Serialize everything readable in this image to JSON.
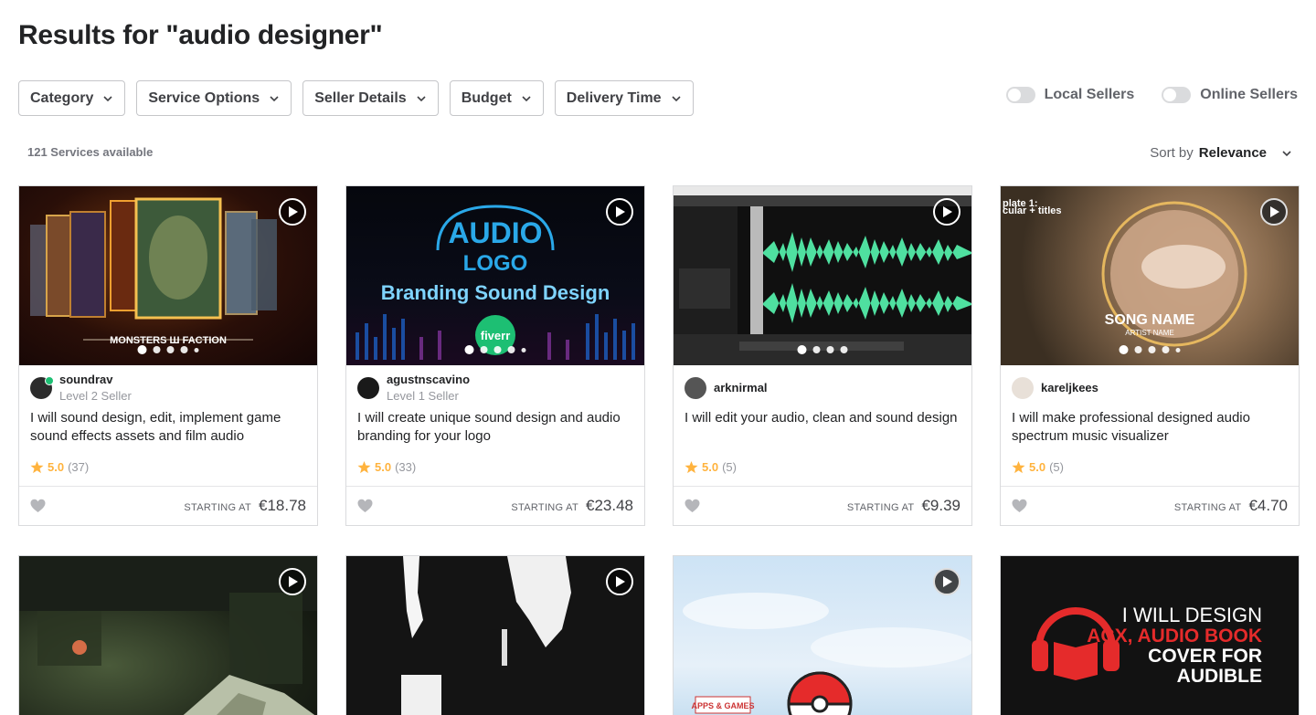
{
  "page_title": "Results for \"audio designer\"",
  "filters": [
    {
      "label": "Category"
    },
    {
      "label": "Service Options"
    },
    {
      "label": "Seller Details"
    },
    {
      "label": "Budget"
    },
    {
      "label": "Delivery Time"
    }
  ],
  "toggles": {
    "local": "Local Sellers",
    "online": "Online Sellers"
  },
  "services_count": "121 Services available",
  "sort": {
    "label": "Sort by",
    "value": "Relevance"
  },
  "price_label": "STARTING AT",
  "colors": {
    "rating": "#ffb33e",
    "online": "#1dbf73",
    "waveform": "#4fe0a0",
    "accent_red": "#e52b2b"
  },
  "thumb_text": {
    "g1_caption": "MONSTERS Ш FACTION",
    "g2_line1": "AUDIO",
    "g2_line2": "LOGO",
    "g2_line3": "Branding Sound Design",
    "g2_badge": "fiverr",
    "g4_top": "plate 1:",
    "g4_top2": "cular + titles",
    "g4_song": "SONG NAME",
    "g4_artist": "ARTIST NAME",
    "g7_tag": "APPS & GAMES",
    "g8_line1": "I WILL DESIGN",
    "g8_line2": "ACX, AUDIO BOOK",
    "g8_line3": "COVER FOR",
    "g8_line4": "AUDIBLE"
  },
  "gigs": [
    {
      "seller": "soundrav",
      "level": "Level 2 Seller",
      "title": "I will sound design, edit, implement game sound effects assets and film audio",
      "score": "5.0",
      "reviews": "(37)",
      "price": "€18.78"
    },
    {
      "seller": "agustnscavino",
      "level": "Level 1 Seller",
      "title": "I will create unique sound design and audio branding for your logo",
      "score": "5.0",
      "reviews": "(33)",
      "price": "€23.48"
    },
    {
      "seller": "arknirmal",
      "level": "",
      "title": "I will edit your audio, clean and sound design",
      "score": "5.0",
      "reviews": "(5)",
      "price": "€9.39"
    },
    {
      "seller": "kareljkees",
      "level": "",
      "title": "I will make professional designed audio spectrum music visualizer",
      "score": "5.0",
      "reviews": "(5)",
      "price": "€4.70"
    }
  ]
}
